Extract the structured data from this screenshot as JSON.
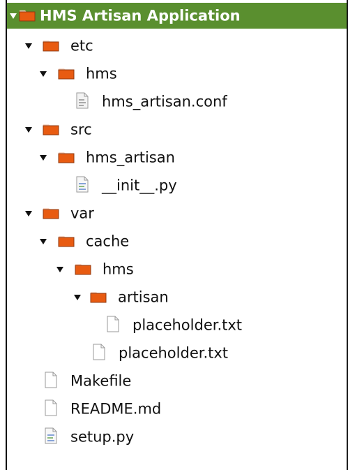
{
  "tree": {
    "root": {
      "label": "HMS Artisan Application"
    },
    "items": [
      {
        "label": "etc"
      },
      {
        "label": "hms"
      },
      {
        "label": "hms_artisan.conf"
      },
      {
        "label": "src"
      },
      {
        "label": "hms_artisan"
      },
      {
        "label": "__init__.py"
      },
      {
        "label": "var"
      },
      {
        "label": "cache"
      },
      {
        "label": "hms"
      },
      {
        "label": "artisan"
      },
      {
        "label": "placeholder.txt"
      },
      {
        "label": "placeholder.txt"
      },
      {
        "label": "Makefile"
      },
      {
        "label": "README.md"
      },
      {
        "label": "setup.py"
      }
    ]
  },
  "theme": {
    "selection_color": "#5a8f2f",
    "folder_color": "#e85b11"
  },
  "icons": {
    "folder": "folder-icon",
    "file": "file-icon",
    "config_file": "config-file-icon",
    "python_file": "python-file-icon"
  }
}
